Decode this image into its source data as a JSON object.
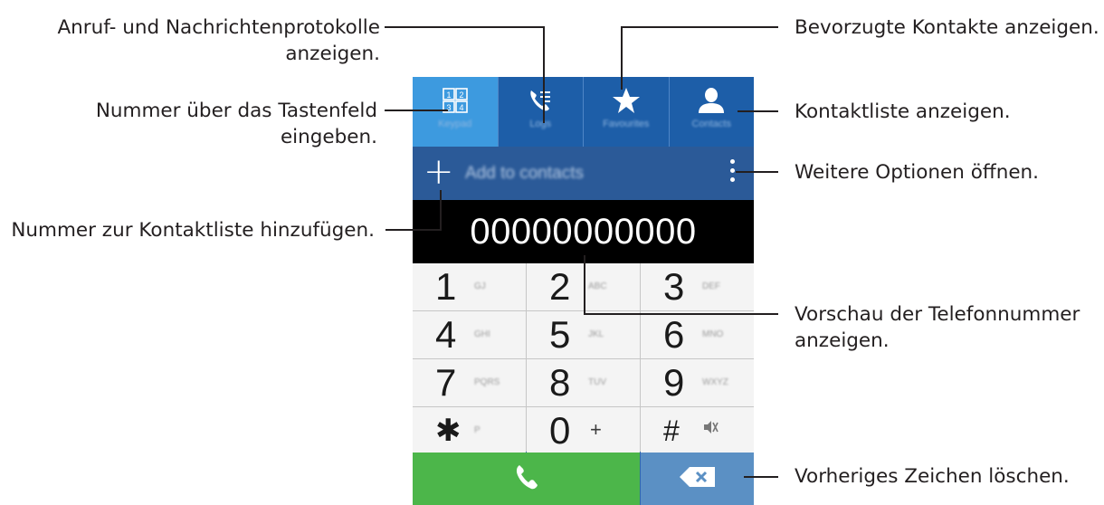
{
  "tabs": [
    {
      "label": "Keypad",
      "icon": "keypad-icon",
      "active": true
    },
    {
      "label": "Logs",
      "icon": "call-log-icon",
      "active": false
    },
    {
      "label": "Favourites",
      "icon": "star-icon",
      "active": false
    },
    {
      "label": "Contacts",
      "icon": "contact-person-icon",
      "active": false
    }
  ],
  "keypad_icon_digits": [
    "1",
    "2",
    "3",
    "4"
  ],
  "add_bar": {
    "plus": "+",
    "label": "Add to contacts"
  },
  "display": {
    "number": "00000000000"
  },
  "keys": [
    {
      "digit": "1",
      "letters": "GJ"
    },
    {
      "digit": "2",
      "letters": "ABC"
    },
    {
      "digit": "3",
      "letters": "DEF"
    },
    {
      "digit": "4",
      "letters": "GHI"
    },
    {
      "digit": "5",
      "letters": "JKL"
    },
    {
      "digit": "6",
      "letters": "MNO"
    },
    {
      "digit": "7",
      "letters": "PQRS"
    },
    {
      "digit": "8",
      "letters": "TUV"
    },
    {
      "digit": "9",
      "letters": "WXYZ"
    },
    {
      "digit": "✱",
      "letters": "P"
    },
    {
      "digit": "0",
      "letters": "+"
    },
    {
      "digit": "#",
      "letters": "mute-icon"
    }
  ],
  "annotations": {
    "logs_line1": "Anruf- und Nachrichtenprotokolle",
    "logs_line2": "anzeigen.",
    "keypad_line1": "Nummer über das Tastenfeld",
    "keypad_line2": "eingeben.",
    "add_contact": "Nummer zur Kontaktliste hinzufügen.",
    "favourites": "Bevorzugte Kontakte anzeigen.",
    "contacts": "Kontaktliste anzeigen.",
    "more": "Weitere Optionen öffnen.",
    "preview_line1": "Vorschau der Telefonnummer",
    "preview_line2": "anzeigen.",
    "delete": "Vorheriges Zeichen löschen."
  },
  "colors": {
    "tab_bar": "#1d5ea8",
    "tab_active": "#3d9adf",
    "add_bar": "#2b5a98",
    "call_button": "#4cb64a",
    "delete_button": "#5b90c4"
  }
}
